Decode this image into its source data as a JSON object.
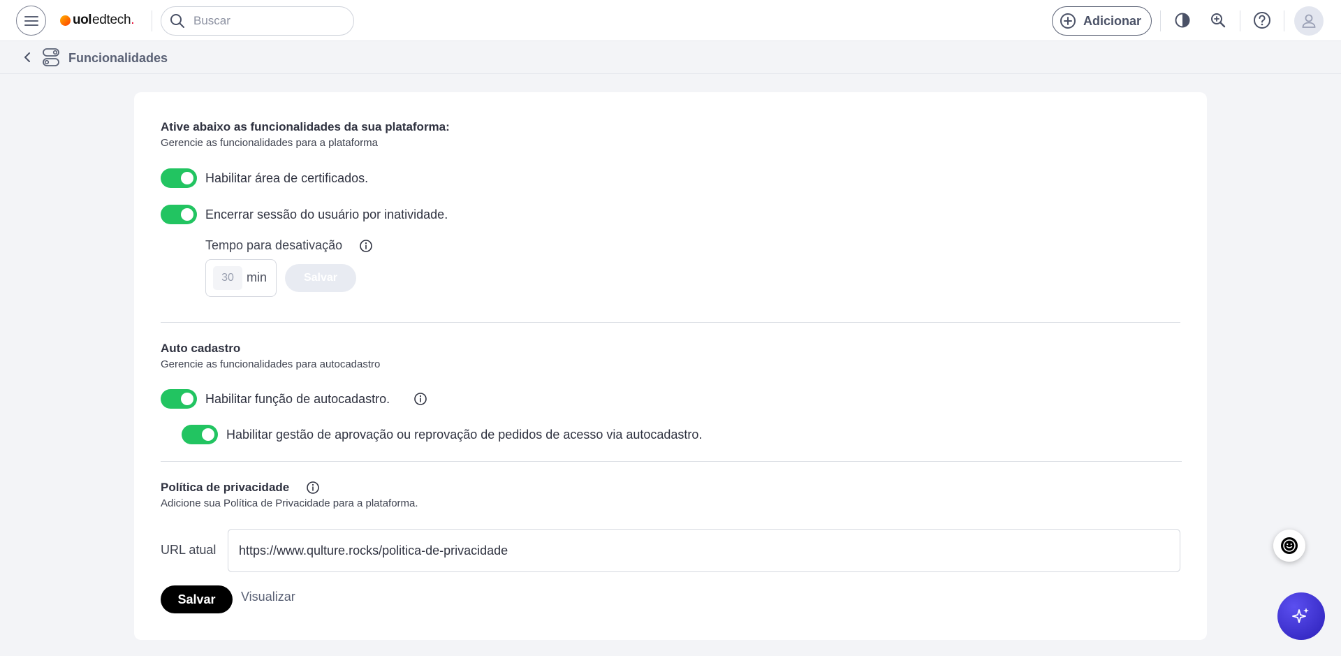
{
  "topbar": {
    "logo": {
      "brand": "uol",
      "product": "edtech",
      "tick": "."
    },
    "search": {
      "placeholder": "Buscar"
    },
    "add_label": "Adicionar",
    "icons": [
      "menu-icon",
      "search-icon",
      "add-circle-icon",
      "contrast-icon",
      "zoom-icon",
      "help-icon",
      "user-icon"
    ]
  },
  "breadcrumb": {
    "title": "Funcionalidades"
  },
  "features": {
    "title": "Ative abaixo as funcionalidades da sua plataforma:",
    "subtitle": "Gerencie as funcionalidades para a plataforma",
    "toggles": [
      {
        "label": "Habilitar área de certificados.",
        "on": true
      },
      {
        "label": "Encerrar sessão do usuário por inatividade.",
        "on": true
      }
    ],
    "timeout": {
      "label": "Tempo para desativação",
      "value": "30",
      "unit": "min",
      "save_label": "Salvar"
    }
  },
  "auto_cadastro": {
    "title": "Auto cadastro",
    "subtitle": "Gerencie as funcionalidades para autocadastro",
    "toggles": [
      {
        "label": "Habilitar função de autocadastro.",
        "on": true
      },
      {
        "label": "Habilitar gestão de aprovação ou reprovação de pedidos de acesso via autocadastro.",
        "on": true
      }
    ]
  },
  "privacy": {
    "title": "Política de privacidade",
    "subtitle": "Adicione sua Política de Privacidade para a plataforma.",
    "url_label": "URL atual",
    "url_value": "https://www.qulture.rocks/politica-de-privacidade",
    "save_label": "Salvar",
    "view_label": "Visualizar"
  },
  "colors": {
    "toggle_on": "#22c461",
    "primary_button": "#000000",
    "ai_button": "#3a2fd0"
  }
}
